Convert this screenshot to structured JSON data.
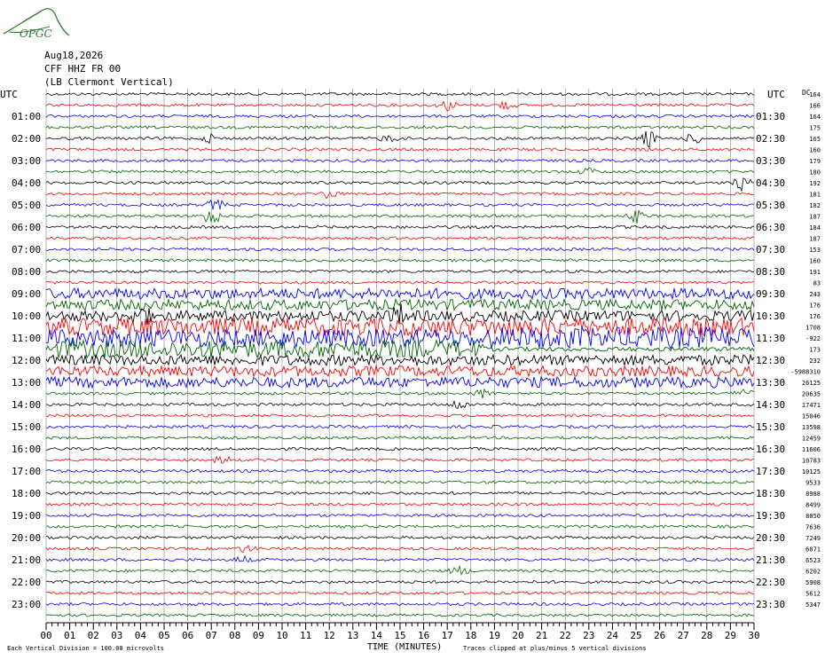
{
  "logo": {
    "text": "OPGC",
    "color": "#2e7d32"
  },
  "header": {
    "date": "Aug18,2026",
    "station": "CFF HHZ FR 00",
    "location": "(LB Clermont Vertical)"
  },
  "left_axis_label": "UTC",
  "right_axis_label": "UTC",
  "dc_label": "DC",
  "footer": {
    "scale_note": "Each Vertical Division =  100.00 microvolts",
    "x_axis_title": "TIME (MINUTES)",
    "clip_note": "Traces clipped at plus/minus 5 vertical divisions"
  },
  "colors": {
    "cycle": [
      "#000000",
      "#ff0000",
      "#0000ff",
      "#006400"
    ],
    "grid": "#808080"
  },
  "chart_data": {
    "type": "line",
    "title": "",
    "xlabel": "TIME (MINUTES)",
    "xlim": [
      0,
      30
    ],
    "x_ticks": [
      "00",
      "01",
      "02",
      "03",
      "04",
      "05",
      "06",
      "07",
      "08",
      "09",
      "10",
      "11",
      "12",
      "13",
      "14",
      "15",
      "16",
      "17",
      "18",
      "19",
      "20",
      "21",
      "22",
      "23",
      "24",
      "25",
      "26",
      "27",
      "28",
      "29",
      "30"
    ],
    "left_hour_labels": [
      "01:00",
      "02:00",
      "03:00",
      "04:00",
      "05:00",
      "06:00",
      "07:00",
      "08:00",
      "09:00",
      "10:00",
      "11:00",
      "12:00",
      "13:00",
      "14:00",
      "15:00",
      "16:00",
      "17:00",
      "18:00",
      "19:00",
      "20:00",
      "21:00",
      "22:00",
      "23:00"
    ],
    "right_half_hour_labels": [
      "01:30",
      "02:30",
      "03:30",
      "04:30",
      "05:30",
      "06:30",
      "07:30",
      "08:30",
      "09:30",
      "10:30",
      "11:30",
      "12:30",
      "13:30",
      "14:30",
      "15:30",
      "16:30",
      "17:30",
      "18:30",
      "19:30",
      "20:30",
      "21:30",
      "22:30",
      "23:30"
    ],
    "dc_offsets": [
      "164",
      "166",
      "164",
      "175",
      "165",
      "160",
      "179",
      "180",
      "192",
      "181",
      "182",
      "187",
      "184",
      "187",
      "153",
      "160",
      "191",
      "83",
      "243",
      "176",
      "176",
      "1708",
      "-922",
      "173",
      "232",
      "-5988310",
      "26125",
      "20635",
      "17471",
      "15046",
      "13598",
      "12459",
      "11606",
      "10783",
      "10125",
      "9533",
      "8988",
      "8499",
      "8050",
      "7636",
      "7249",
      "6871",
      "6523",
      "6202",
      "5908",
      "5612",
      "5347"
    ],
    "traces_count": 48,
    "series": [
      {
        "name": "",
        "trace_index_range": [
          0,
          47
        ],
        "color_cycle": [
          "#000000",
          "#ff0000",
          "#0000ff",
          "#006400"
        ]
      }
    ],
    "events": [
      {
        "trace": 1,
        "minute": 17.0,
        "amp": 6
      },
      {
        "trace": 1,
        "minute": 19.5,
        "amp": 5
      },
      {
        "trace": 4,
        "minute": 7.0,
        "amp": 5
      },
      {
        "trace": 4,
        "minute": 14.5,
        "amp": 4
      },
      {
        "trace": 4,
        "minute": 25.5,
        "amp": 10
      },
      {
        "trace": 4,
        "minute": 27.5,
        "amp": 6
      },
      {
        "trace": 7,
        "minute": 23.0,
        "amp": 4
      },
      {
        "trace": 8,
        "minute": 29.5,
        "amp": 8
      },
      {
        "trace": 9,
        "minute": 12.0,
        "amp": 6
      },
      {
        "trace": 10,
        "minute": 7.2,
        "amp": 7
      },
      {
        "trace": 11,
        "minute": 7.0,
        "amp": 12
      },
      {
        "trace": 11,
        "minute": 25.0,
        "amp": 7
      },
      {
        "trace": 20,
        "minute": 4.0,
        "amp": 10
      },
      {
        "trace": 20,
        "minute": 15.0,
        "amp": 9
      },
      {
        "trace": 27,
        "minute": 18.5,
        "amp": 5
      },
      {
        "trace": 27,
        "minute": 29.5,
        "amp": 7
      },
      {
        "trace": 28,
        "minute": 17.5,
        "amp": 6
      },
      {
        "trace": 33,
        "minute": 7.5,
        "amp": 5
      },
      {
        "trace": 41,
        "minute": 8.5,
        "amp": 4
      },
      {
        "trace": 42,
        "minute": 8.3,
        "amp": 4
      },
      {
        "trace": 43,
        "minute": 17.5,
        "amp": 5
      }
    ],
    "noisy_window": {
      "trace_range": [
        18,
        26
      ],
      "minute_range": [
        0,
        30
      ]
    },
    "grid": true
  }
}
